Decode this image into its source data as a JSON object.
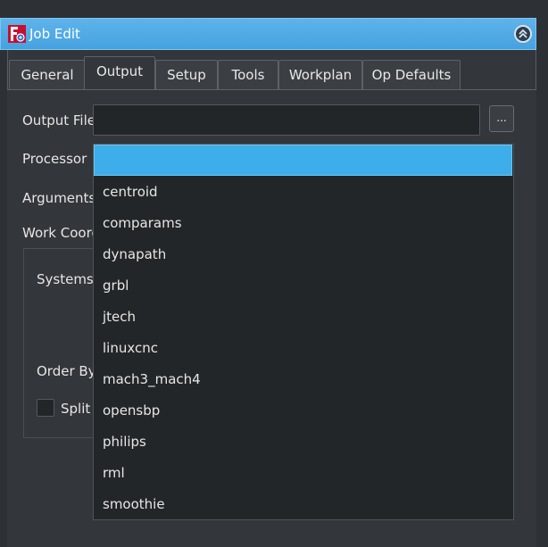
{
  "window": {
    "title": "Job Edit",
    "app_icon": "freecad-icon",
    "collapse_icon": "collapse-up-icon"
  },
  "tabs": [
    {
      "label": "General"
    },
    {
      "label": "Output"
    },
    {
      "label": "Setup"
    },
    {
      "label": "Tools"
    },
    {
      "label": "Workplan"
    },
    {
      "label": "Op Defaults"
    }
  ],
  "active_tab": "Output",
  "form": {
    "output_file_label": "Output File",
    "output_file_value": "",
    "browse_label": "...",
    "processor_label": "Processor",
    "arguments_label": "Arguments",
    "work_coord_label": "Work Coordi",
    "systems_label": "Systems",
    "order_by_label": "Order By",
    "split_label": "Split C"
  },
  "processor_dropdown": {
    "selected": "",
    "options": [
      "centroid",
      "comparams",
      "dynapath",
      "grbl",
      "jtech",
      "linuxcnc",
      "mach3_mach4",
      "opensbp",
      "philips",
      "rml",
      "smoothie"
    ]
  },
  "colors": {
    "accent": "#3daee9",
    "background": "#33363b",
    "field": "#232629"
  }
}
